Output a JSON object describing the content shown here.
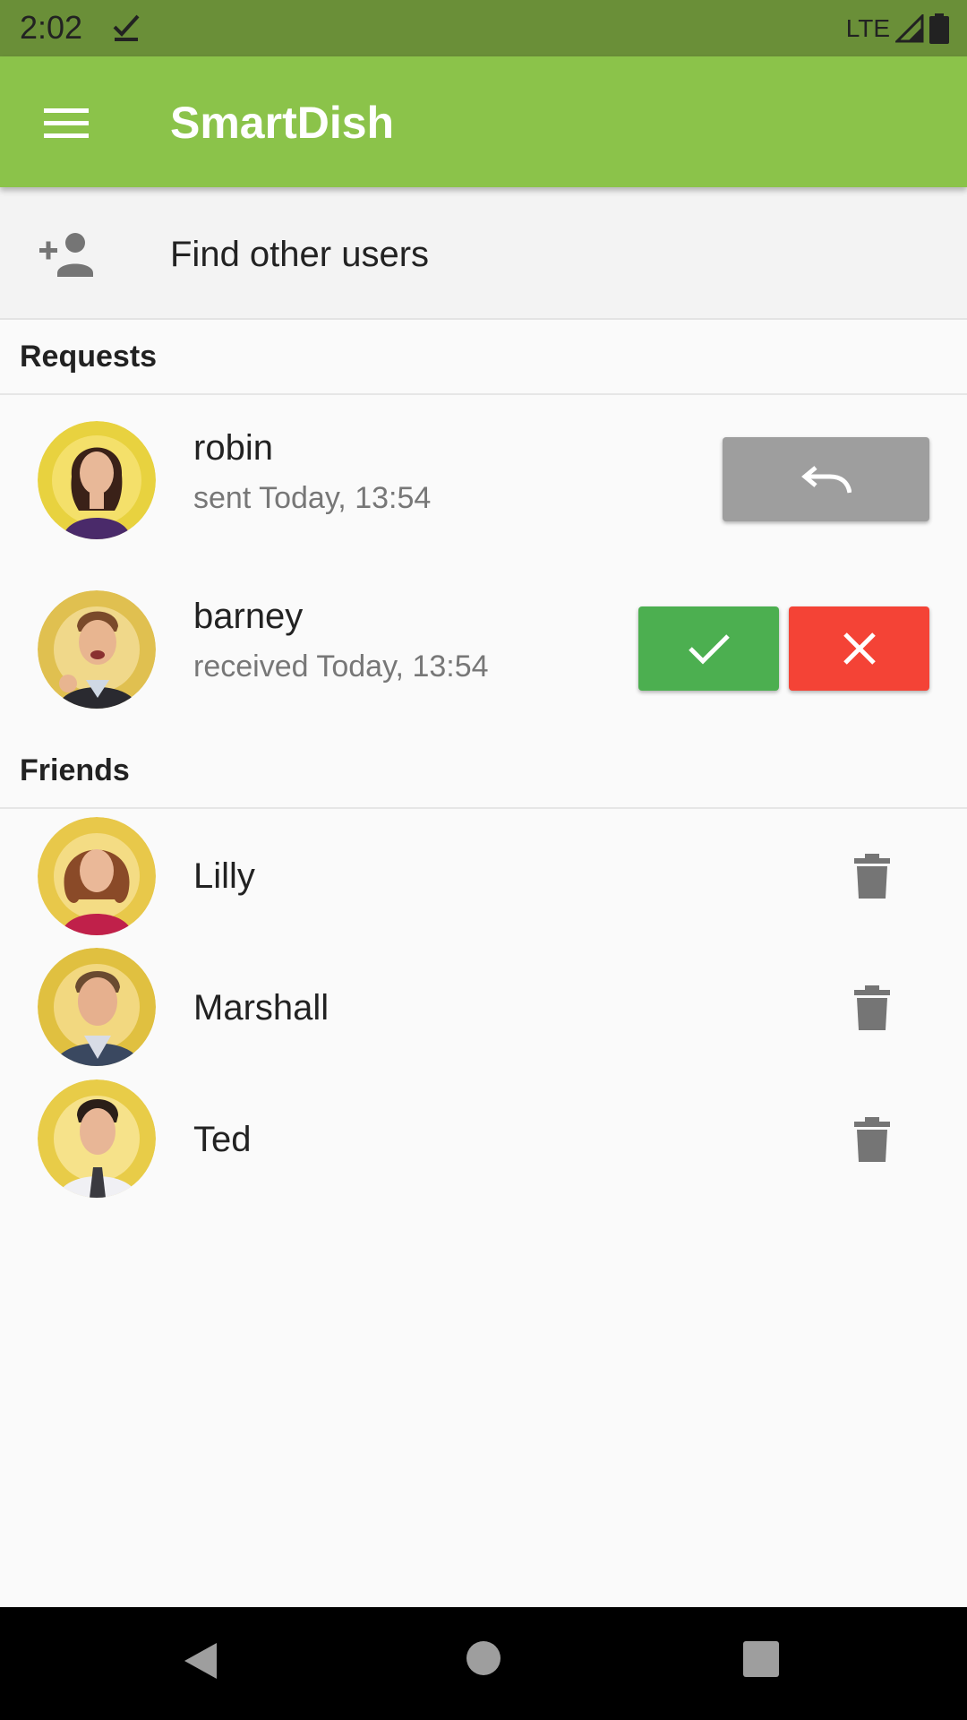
{
  "status_bar": {
    "time": "2:02",
    "network": "LTE"
  },
  "app_bar": {
    "title": "SmartDish",
    "menu_icon": "hamburger-menu-icon"
  },
  "find_users": {
    "label": "Find other users",
    "icon": "person-add-icon"
  },
  "requests": {
    "header": "Requests",
    "items": [
      {
        "name": "robin",
        "status": "sent Today, 13:54",
        "actions": [
          "undo"
        ]
      },
      {
        "name": "barney",
        "status": "received Today, 13:54",
        "actions": [
          "accept",
          "decline"
        ]
      }
    ]
  },
  "friends": {
    "header": "Friends",
    "items": [
      {
        "name": "Lilly"
      },
      {
        "name": "Marshall"
      },
      {
        "name": "Ted"
      }
    ]
  },
  "colors": {
    "app_bar": "#8bc34a",
    "status_bar": "#6a8f38",
    "accept": "#4caf50",
    "decline": "#f44336",
    "undo": "#9e9e9e"
  }
}
